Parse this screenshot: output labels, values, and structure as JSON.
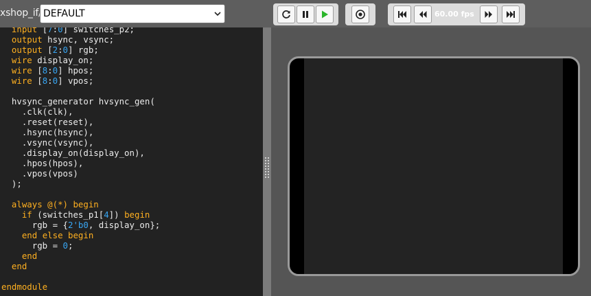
{
  "toolbar": {
    "path_label": "xshop_if/",
    "preset": {
      "value": "DEFAULT"
    },
    "controls": {
      "reset": "reset-icon",
      "pause": "pause-icon",
      "play": "play-icon",
      "record": "record-icon"
    },
    "playback": {
      "fps": "60.00 fps"
    },
    "colors": {
      "play": "#2bb52b",
      "toolbar": "#5e5e5e"
    }
  },
  "editor": {
    "lines": [
      "  input [7:0] switches_p2;",
      "  output hsync, vsync;",
      "  output [2:0] rgb;",
      "  wire display_on;",
      "  wire [8:0] hpos;",
      "  wire [8:0] vpos;",
      "",
      "  hvsync_generator hvsync_gen(",
      "    .clk(clk),",
      "    .reset(reset),",
      "    .hsync(hsync),",
      "    .vsync(vsync),",
      "    .display_on(display_on),",
      "    .hpos(hpos),",
      "    .vpos(vpos)",
      "  );",
      "",
      "  always @(*) begin",
      "    if (switches_p1[4]) begin",
      "      rgb = {2'b0, display_on};",
      "    end else begin",
      "      rgb = 0;",
      "    end",
      "  end",
      "",
      "endmodule"
    ],
    "colors": {
      "background": "#222222",
      "keyword": "#ffb020",
      "number": "#38a6f4",
      "text": "#ececec"
    }
  }
}
